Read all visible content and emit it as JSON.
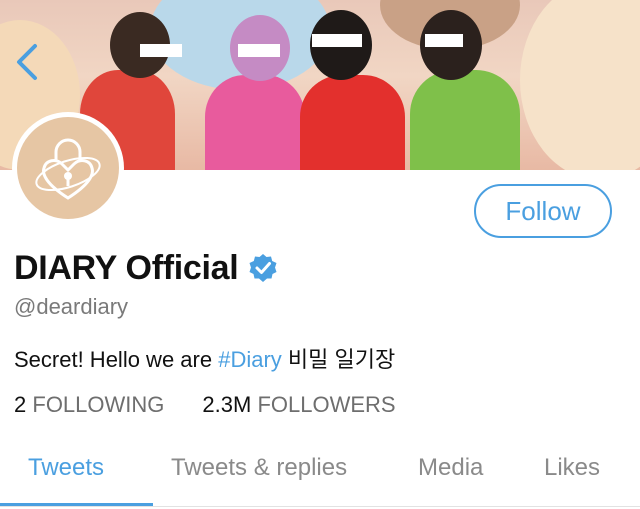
{
  "profile": {
    "display_name": "DIARY Official",
    "handle": "@deardiary",
    "bio_prefix": "Secret! Hello we are ",
    "bio_hashtag": "#Diary",
    "bio_suffix": " 비밀 일기장",
    "verified_icon": "verified-badge-icon",
    "avatar_icon": "heart-padlock-icon"
  },
  "actions": {
    "back_icon": "chevron-left-icon",
    "follow_label": "Follow"
  },
  "stats": {
    "following_count": "2",
    "following_label": "FOLLOWING",
    "followers_count": "2.3M",
    "followers_label": "FOLLOWERS"
  },
  "tabs": [
    {
      "label": "Tweets",
      "active": true
    },
    {
      "label": "Tweets & replies",
      "active": false
    },
    {
      "label": "Media",
      "active": false
    },
    {
      "label": "Likes",
      "active": false
    }
  ],
  "colors": {
    "accent": "#4a9fe0",
    "avatar_bg": "#e6c6a4",
    "text": "#111111",
    "muted": "#7a7a7a"
  }
}
